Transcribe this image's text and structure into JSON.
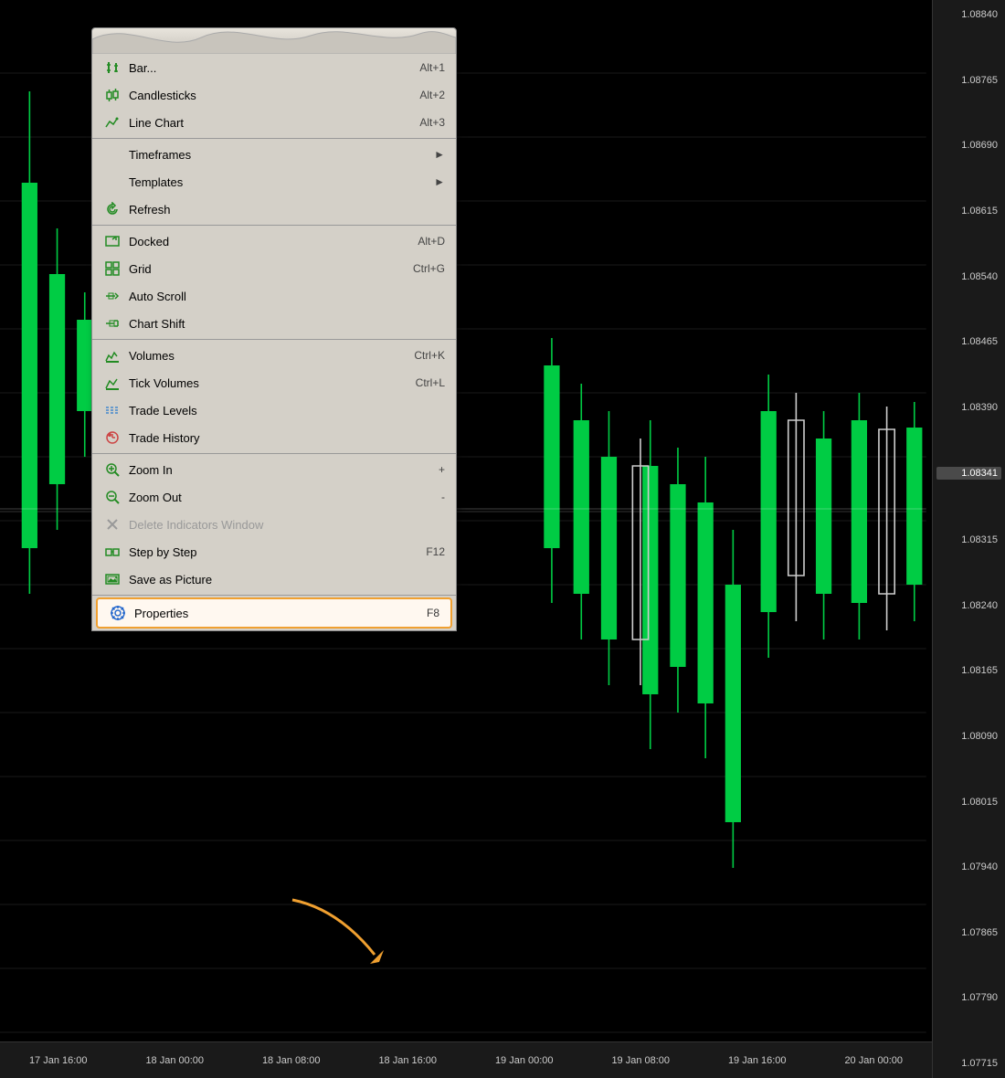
{
  "chart": {
    "background": "#000000",
    "price_labels": [
      "1.08840",
      "1.08765",
      "1.08690",
      "1.08615",
      "1.08540",
      "1.08465",
      "1.08390",
      "1.08341",
      "1.08315",
      "1.08240",
      "1.08165",
      "1.08090",
      "1.08015",
      "1.07940",
      "1.07865",
      "1.07790",
      "1.07715"
    ],
    "current_price": "1.08341",
    "time_labels": [
      "17 Jan 16:00",
      "18 Jan 00:00",
      "18 Jan 08:00",
      "18 Jan 16:00",
      "19 Jan 00:00",
      "19 Jan 08:00",
      "19 Jan 16:00",
      "20 Jan 00:00"
    ]
  },
  "context_menu": {
    "items": [
      {
        "id": "bar-chart",
        "label": "Bar...",
        "shortcut": "Alt+1",
        "icon": "bar-chart-icon",
        "separator_after": false,
        "disabled": false,
        "has_submenu": false
      },
      {
        "id": "candlesticks",
        "label": "Candlesticks",
        "shortcut": "Alt+2",
        "icon": "candlestick-icon",
        "separator_after": false,
        "disabled": false,
        "has_submenu": false
      },
      {
        "id": "line-chart",
        "label": "Line Chart",
        "shortcut": "Alt+3",
        "icon": "line-chart-icon",
        "separator_after": true,
        "disabled": false,
        "has_submenu": false
      },
      {
        "id": "timeframes",
        "label": "Timeframes",
        "shortcut": "",
        "icon": "",
        "separator_after": false,
        "disabled": false,
        "has_submenu": true
      },
      {
        "id": "templates",
        "label": "Templates",
        "shortcut": "",
        "icon": "",
        "separator_after": false,
        "disabled": false,
        "has_submenu": true
      },
      {
        "id": "refresh",
        "label": "Refresh",
        "shortcut": "",
        "icon": "refresh-icon",
        "separator_after": true,
        "disabled": false,
        "has_submenu": false
      },
      {
        "id": "docked",
        "label": "Docked",
        "shortcut": "Alt+D",
        "icon": "docked-icon",
        "separator_after": false,
        "disabled": false,
        "has_submenu": false
      },
      {
        "id": "grid",
        "label": "Grid",
        "shortcut": "Ctrl+G",
        "icon": "grid-icon",
        "separator_after": false,
        "disabled": false,
        "has_submenu": false
      },
      {
        "id": "auto-scroll",
        "label": "Auto Scroll",
        "shortcut": "",
        "icon": "autoscroll-icon",
        "separator_after": false,
        "disabled": false,
        "has_submenu": false
      },
      {
        "id": "chart-shift",
        "label": "Chart Shift",
        "shortcut": "",
        "icon": "chartshift-icon",
        "separator_after": true,
        "disabled": false,
        "has_submenu": false
      },
      {
        "id": "volumes",
        "label": "Volumes",
        "shortcut": "Ctrl+K",
        "icon": "volumes-icon",
        "separator_after": false,
        "disabled": false,
        "has_submenu": false
      },
      {
        "id": "tick-volumes",
        "label": "Tick Volumes",
        "shortcut": "Ctrl+L",
        "icon": "tick-volumes-icon",
        "separator_after": false,
        "disabled": false,
        "has_submenu": false
      },
      {
        "id": "trade-levels",
        "label": "Trade Levels",
        "shortcut": "",
        "icon": "trade-levels-icon",
        "separator_after": false,
        "disabled": false,
        "has_submenu": false
      },
      {
        "id": "trade-history",
        "label": "Trade History",
        "shortcut": "",
        "icon": "trade-history-icon",
        "separator_after": true,
        "disabled": false,
        "has_submenu": false
      },
      {
        "id": "zoom-in",
        "label": "Zoom In",
        "shortcut": "+",
        "icon": "zoom-in-icon",
        "separator_after": false,
        "disabled": false,
        "has_submenu": false
      },
      {
        "id": "zoom-out",
        "label": "Zoom Out",
        "shortcut": "-",
        "icon": "zoom-out-icon",
        "separator_after": false,
        "disabled": false,
        "has_submenu": false
      },
      {
        "id": "delete-indicators",
        "label": "Delete Indicators Window",
        "shortcut": "",
        "icon": "delete-icon",
        "separator_after": false,
        "disabled": true,
        "has_submenu": false
      },
      {
        "id": "step-by-step",
        "label": "Step by Step",
        "shortcut": "F12",
        "icon": "step-icon",
        "separator_after": false,
        "disabled": false,
        "has_submenu": false
      },
      {
        "id": "save-as-picture",
        "label": "Save as Picture",
        "shortcut": "",
        "icon": "save-pic-icon",
        "separator_after": true,
        "disabled": false,
        "has_submenu": false
      },
      {
        "id": "properties",
        "label": "Properties",
        "shortcut": "F8",
        "icon": "properties-icon",
        "separator_after": false,
        "disabled": false,
        "has_submenu": false,
        "highlighted": true
      }
    ]
  },
  "annotation": {
    "arrow_color": "#f0a030",
    "points_to": "properties"
  }
}
